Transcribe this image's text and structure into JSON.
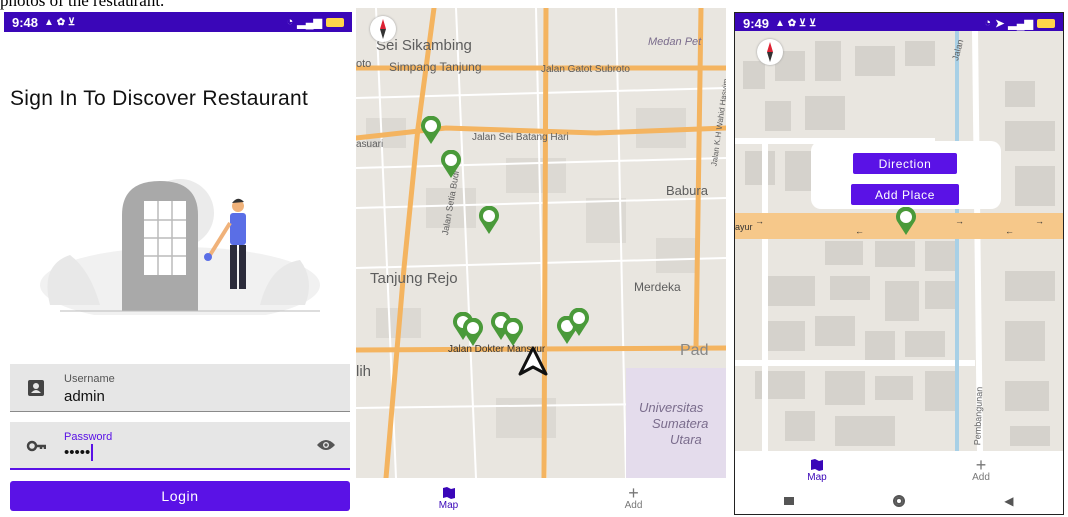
{
  "caption": "photos of the restaurant.",
  "colors": {
    "primary": "#5a12e6",
    "statusbar": "#3a06b8",
    "pin": "#4a9a3a",
    "road": "#f6c88a"
  },
  "phone1": {
    "status": {
      "time": "9:48"
    },
    "title": "Sign In To Discover Restaurant",
    "username": {
      "label": "Username",
      "value": "admin",
      "icon": "account-box-icon"
    },
    "password": {
      "label": "Password",
      "value": "•••••",
      "icon": "key-icon",
      "toggle_icon": "eye-icon"
    },
    "login_label": "Login"
  },
  "phone2": {
    "labels": {
      "sei_sikambing": "Sei Sikambing",
      "medan_pet": "Medan Pet",
      "simpang_tanjung": "Simpang Tanjung",
      "jalan_gatot": "Jalan Gatot Subroto",
      "toto": "oto",
      "asuari": "asuari",
      "jalan_sei_batang": "Jalan Sei Batang Hari",
      "babura": "Babura",
      "tanjung_rejo": "Tanjung Rejo",
      "merdeka": "Merdeka",
      "jalan_dokter": "Jalan Dokter Mansyur",
      "pad": "Pad",
      "lih": "lih",
      "univ": "Universitas",
      "sumatera": "Sumatera",
      "utara": "Utara",
      "jalan_setia": "Jalan Setia Budi",
      "jalan_sei": "Jalan Sei",
      "jalan_kh": "Jalan K.H Wahid Hasyim"
    },
    "nav": [
      {
        "label": "Map",
        "icon": "map-icon"
      },
      {
        "label": "Add",
        "icon": "plus-icon"
      }
    ]
  },
  "phone3": {
    "status": {
      "time": "9:49"
    },
    "direction_label": "Direction",
    "add_place_label": "Add Place",
    "labels": {
      "jalan": "Jalan",
      "pembangunan": "Pembangunan",
      "ayur": "ayur"
    },
    "nav": [
      {
        "label": "Map",
        "icon": "map-icon"
      },
      {
        "label": "Add",
        "icon": "plus-icon"
      }
    ],
    "system_nav": [
      "square-icon",
      "circle-icon",
      "back-triangle-icon"
    ]
  }
}
